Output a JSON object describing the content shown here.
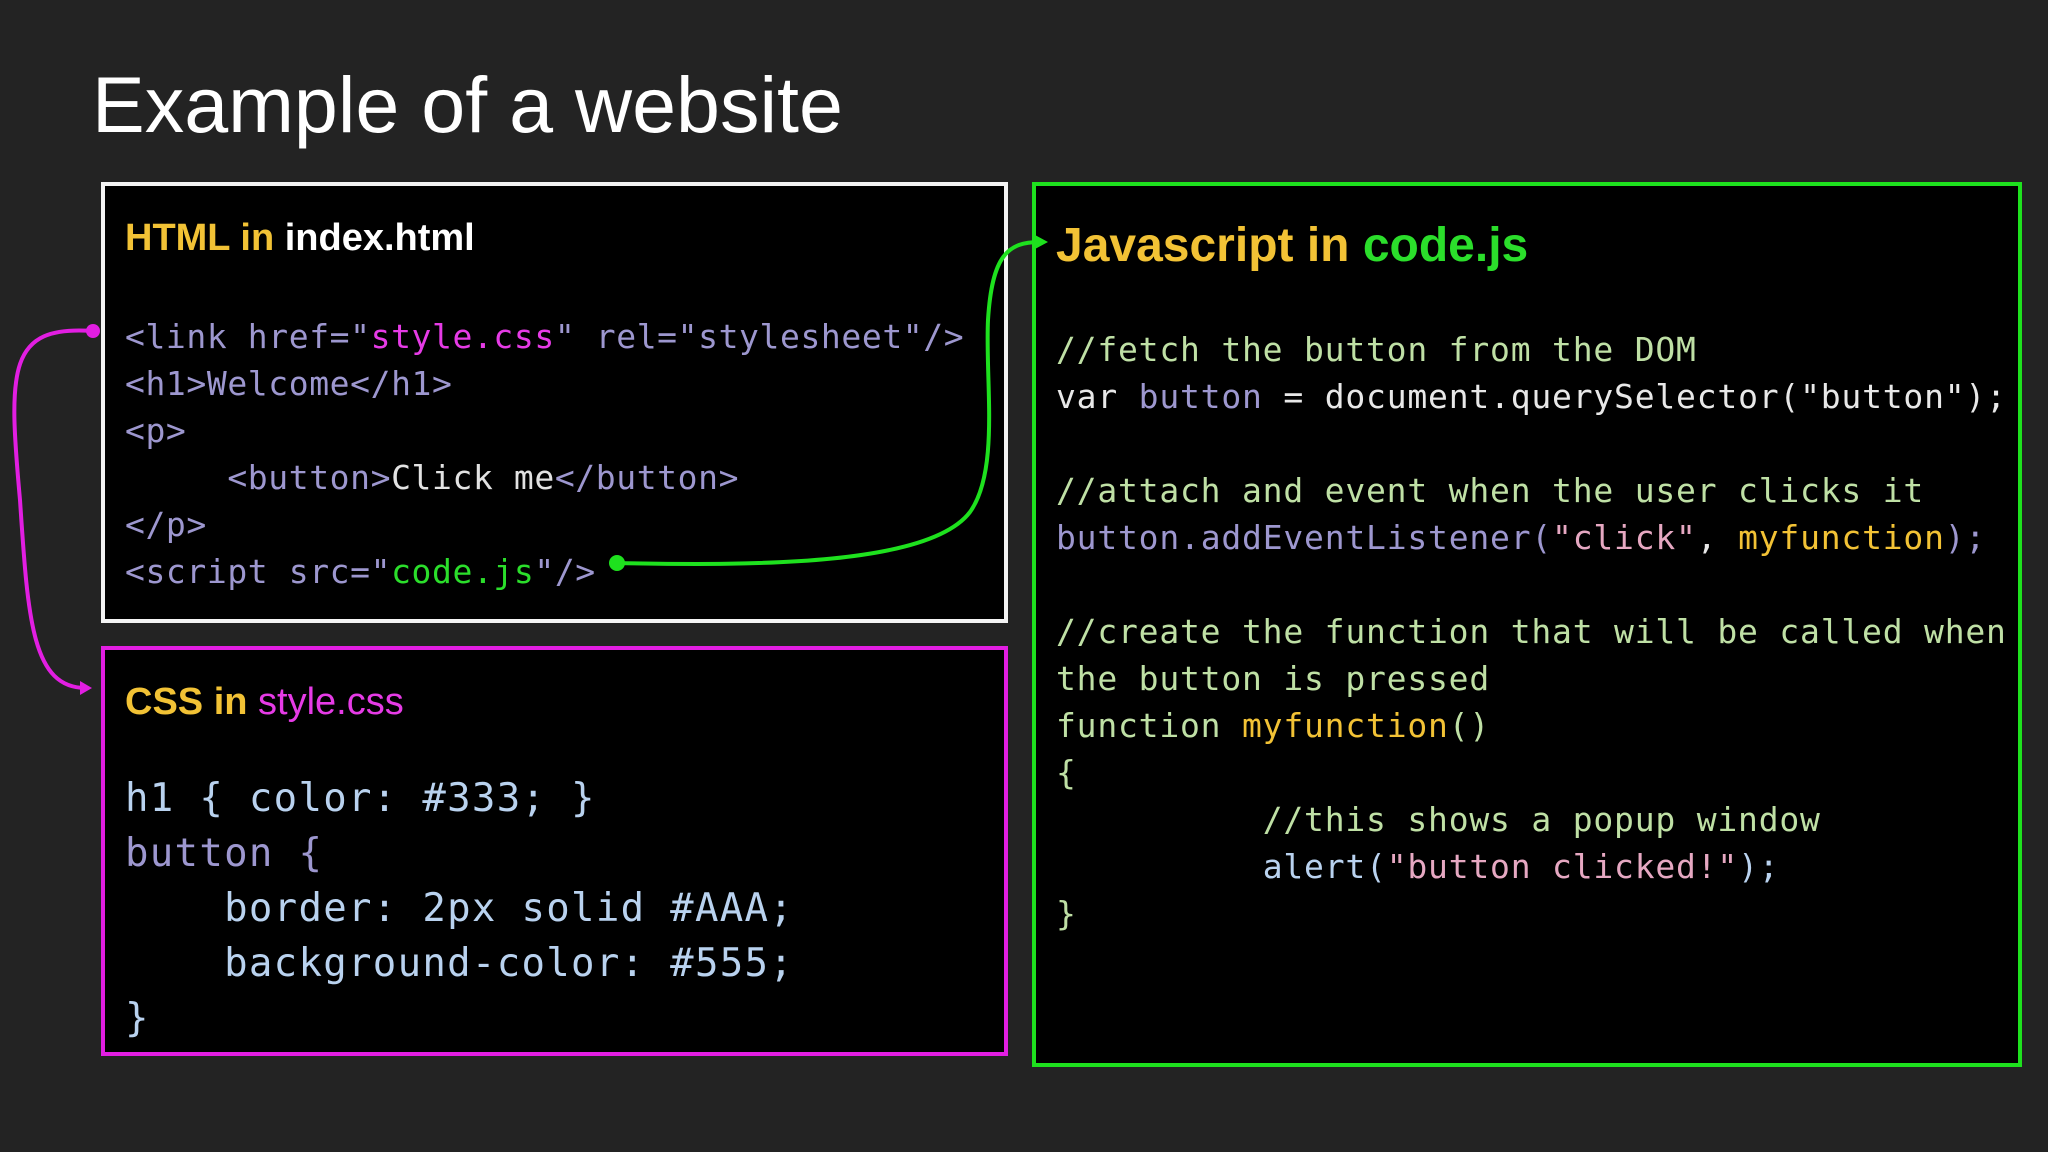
{
  "title": "Example of a website",
  "colors": {
    "background": "#232323",
    "html_border": "#f4f4f4",
    "css_border": "#e21ee2",
    "js_border": "#1ee11e",
    "heading_yellow": "#f2c235",
    "magenta": "#e63be6",
    "green": "#2bde2b"
  },
  "html_panel": {
    "heading_prefix": "HTML in ",
    "heading_file": "index.html",
    "lines": {
      "l1_open": "<link href=\"",
      "l1_file": "style.css",
      "l1_rest": "\" rel=\"stylesheet\"/>",
      "l2": "<h1>Welcome</h1>",
      "l3": "<p>",
      "l4_indent": "     ",
      "l4_open": "<button>",
      "l4_text": "Click me",
      "l4_close": "</button>",
      "l5": "</p>",
      "l6_open": "<script src=\"",
      "l6_file": "code.js",
      "l6_rest": "\"/>"
    }
  },
  "css_panel": {
    "heading_prefix": "CSS in ",
    "heading_file": "style.css",
    "lines": [
      "h1 { color: #333; }",
      "button {",
      "    border: 2px solid #AAA;",
      "    background-color: #555;",
      "}"
    ]
  },
  "js_panel": {
    "heading_prefix": "Javascript in ",
    "heading_file": "code.js",
    "lines": {
      "c1": "//fetch the button from the DOM",
      "l2_kw": "var ",
      "l2_var": "button",
      "l2_eq": " = ",
      "l2_obj": "document",
      "l2_dot": ".",
      "l2_fn": "querySelector",
      "l2_open": "(",
      "l2_str": "\"button\"",
      "l2_close": ");",
      "c3": "//attach and event when the user clicks it",
      "l4_var": "button",
      "l4_dot": ".",
      "l4_fn": "addEventListener",
      "l4_open": "(",
      "l4_str": "\"click\"",
      "l4_comma": ", ",
      "l4_arg": "myfunction",
      "l4_close": ");",
      "c5a": "//create the function that will be called when",
      "c5b": "the button is pressed",
      "l6_kw": "function ",
      "l6_name": "myfunction",
      "l6_parens": "()",
      "l7": "{",
      "c8_indent": "          ",
      "c8": "//this shows a popup window",
      "l9_indent": "          ",
      "l9_fn": "alert",
      "l9_open": "(",
      "l9_str": "\"button clicked!\"",
      "l9_close": ");",
      "l10": "}"
    }
  }
}
